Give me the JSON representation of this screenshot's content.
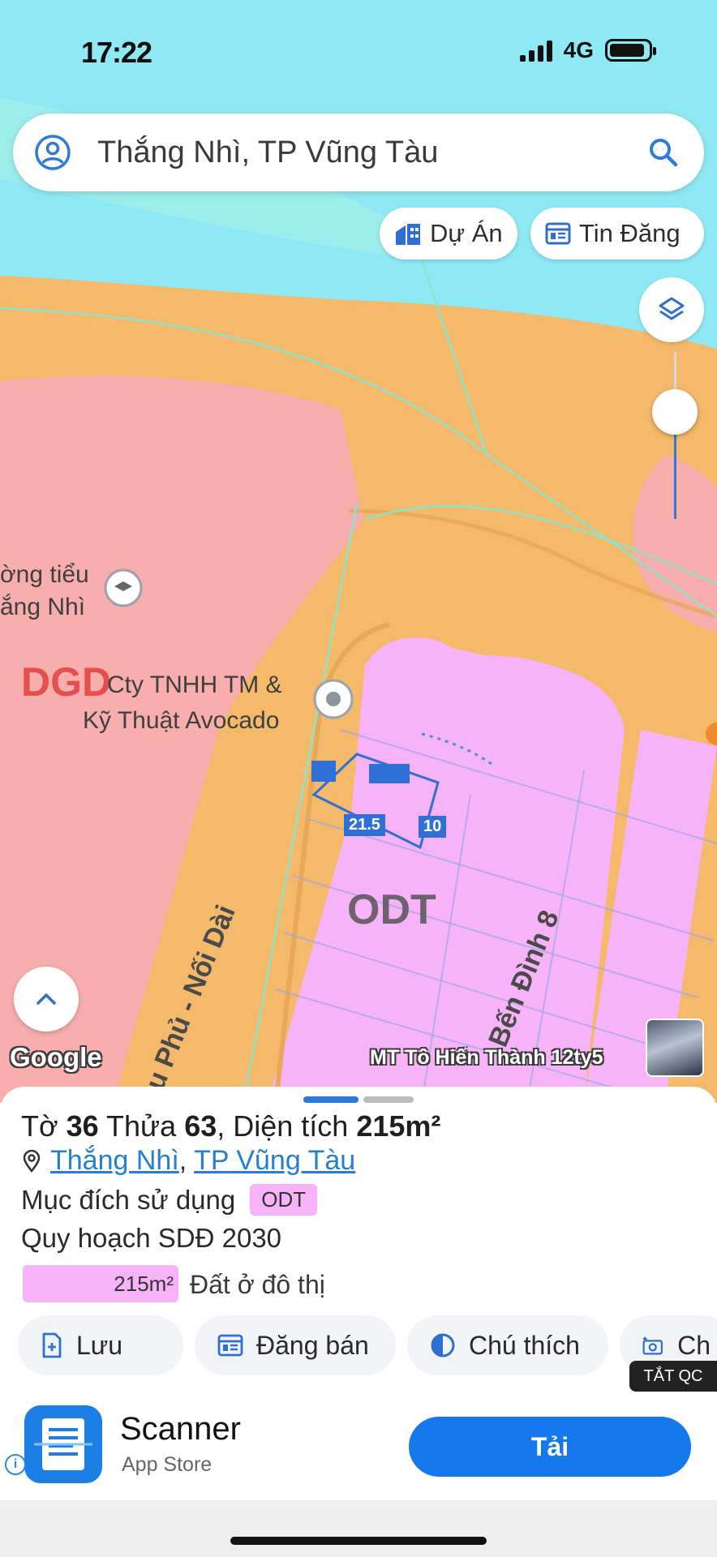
{
  "status_bar": {
    "time": "17:22",
    "network": "4G"
  },
  "search": {
    "value": "Thắng Nhì, TP Vũng Tàu",
    "icon_left": "user-circle-icon",
    "icon_right": "search-icon"
  },
  "chips": [
    {
      "label": "Dự Án",
      "icon": "buildings-icon"
    },
    {
      "label": "Tin Đăng",
      "icon": "newspaper-icon"
    }
  ],
  "map": {
    "labels": {
      "school_line1": "ờng tiểu",
      "school_line2": "ắng Nhì",
      "zone_dgd": "DGD",
      "company_line1": "Cty TNHH TM &",
      "company_line2": "Kỹ Thuật Avocado",
      "zone_odt": "ODT",
      "dim_long": "21.5",
      "dim_short": "10",
      "street_left": "u Phủ - Nối Dài",
      "street_right": "Bến Đình 8",
      "listing_caption": "MT Tô Hiến Thành 12ty5",
      "attribution": "Google"
    },
    "colors": {
      "water": "#8fe9f4",
      "road": "#f5b96b",
      "education_zone": "#f7aeac",
      "residential_zone": "#f7b3f7",
      "selected_parcel": "#2f6fd6"
    }
  },
  "sheet": {
    "to_label": "Tờ",
    "to_value": "36",
    "thua_label": "Thửa",
    "thua_value": "63",
    "area_label": "Diện tích",
    "area_value": "215m²",
    "ward": "Thắng Nhì",
    "city": "TP Vũng Tàu",
    "purpose_label": "Mục đích sử dụng",
    "purpose_tag": "ODT",
    "plan_label": "Quy hoạch SDĐ 2030",
    "plan_area": "215m²",
    "plan_desc": "Đất ở đô thị",
    "actions": [
      {
        "label": "Lưu",
        "icon": "save-doc-icon"
      },
      {
        "label": "Đăng bán",
        "icon": "calendar-icon"
      },
      {
        "label": "Chú thích",
        "icon": "contrast-icon"
      },
      {
        "label": "Ch",
        "icon": "camera-plus-icon"
      }
    ]
  },
  "ad": {
    "close_label": "TẮT QC",
    "app_name": "Scanner",
    "store": "App Store",
    "cta": "Tải"
  }
}
